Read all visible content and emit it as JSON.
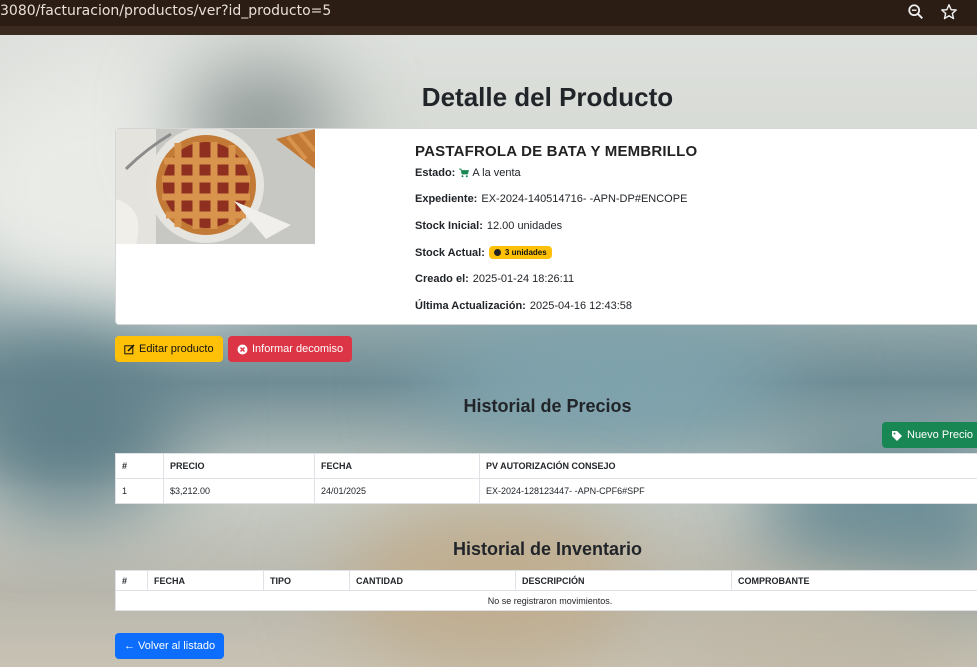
{
  "browser": {
    "url": "3080/facturacion/productos/ver?id_producto=5",
    "zoom_icon": "zoom-out-icon",
    "bookmark_icon": "star-icon"
  },
  "page": {
    "title": "Detalle del Producto"
  },
  "product": {
    "name": "PASTAFROLA DE BATA Y MEMBRILLO",
    "estado_label": "Estado:",
    "estado_value": "A la venta",
    "expediente_label": "Expediente:",
    "expediente_value": "EX-2024-140514716- -APN-DP#ENCOPE",
    "stock_inicial_label": "Stock Inicial:",
    "stock_inicial_value": "12.00 unidades",
    "stock_actual_label": "Stock Actual:",
    "stock_actual_badge": "3 unidades",
    "creado_label": "Creado el:",
    "creado_value": "2025-01-24 18:26:11",
    "actualizacion_label": "Última Actualización:",
    "actualizacion_value": "2025-04-16 12:43:58"
  },
  "actions": {
    "edit_label": "Editar producto",
    "decomiso_label": "Informar decomiso"
  },
  "precios": {
    "title": "Historial de Precios",
    "new_label": "Nuevo Precio",
    "headers": [
      "#",
      "PRECIO",
      "FECHA",
      "PV AUTORIZACIÓN CONSEJO"
    ],
    "rows": [
      [
        "1",
        "$3,212.00",
        "24/01/2025",
        "EX-2024-128123447- -APN-CPF6#SPF"
      ]
    ]
  },
  "inventario": {
    "title": "Historial de Inventario",
    "headers": [
      "#",
      "FECHA",
      "TIPO",
      "CANTIDAD",
      "DESCRIPCIÓN",
      "COMPROBANTE"
    ],
    "empty": "No se registraron movimientos."
  },
  "footer": {
    "back_label": "← Volver al listado"
  },
  "colors": {
    "warning": "#ffc107",
    "danger": "#dc3545",
    "success": "#198754",
    "primary": "#0d6efd"
  }
}
